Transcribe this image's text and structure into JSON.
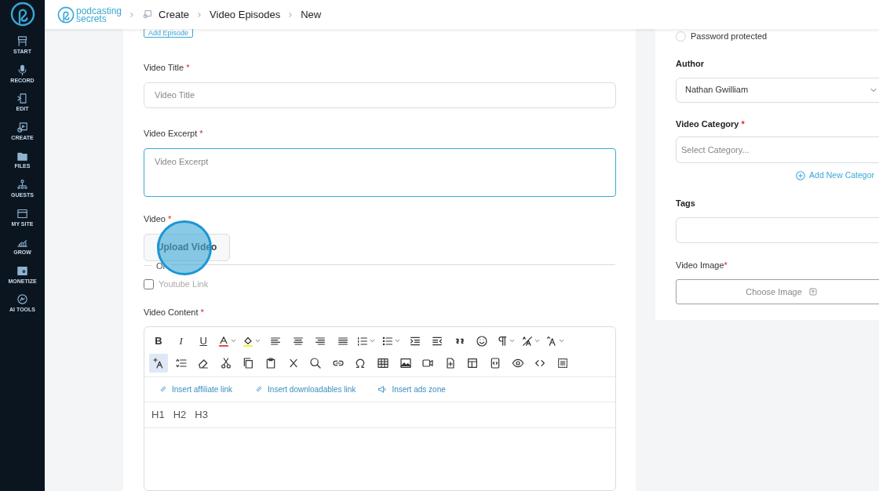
{
  "sidebar": {
    "items": [
      {
        "kind": "start",
        "label": "START"
      },
      {
        "kind": "record",
        "label": "RECORD"
      },
      {
        "kind": "edit",
        "label": "EDIT"
      },
      {
        "kind": "create",
        "label": "CREATE"
      },
      {
        "kind": "files",
        "label": "FILES"
      },
      {
        "kind": "guests",
        "label": "GUESTS"
      },
      {
        "kind": "site",
        "label": "MY SITE"
      },
      {
        "kind": "grow",
        "label": "GROW"
      },
      {
        "kind": "monetize",
        "label": "MONETIZE"
      },
      {
        "kind": "ai",
        "label": "AI TOOLS"
      }
    ]
  },
  "header": {
    "logo_top": "podcasting",
    "logo_bottom": "secrets",
    "breadcrumb": [
      "Create",
      "Video Episodes",
      "New"
    ]
  },
  "form": {
    "add_episode_button": "Add Episode",
    "title_label": "Video Title",
    "title_placeholder": "Video Title",
    "excerpt_label": "Video Excerpt",
    "excerpt_placeholder": "Video Excerpt",
    "video_label": "Video",
    "upload_button": "Upload Video",
    "or_text": "Or",
    "youtube": {
      "label": "Youtube Link",
      "checked": false
    },
    "content_label": "Video Content",
    "required_mark": "*",
    "toolbar_rows": [
      [
        {
          "kind": "bold",
          "label": "B",
          "selected": false
        },
        {
          "kind": "italic",
          "label": "I",
          "selected": false
        },
        {
          "kind": "underline",
          "label": "U",
          "selected": false
        },
        {
          "kind": "font-color",
          "selected": false
        },
        {
          "kind": "highlight",
          "selected": false
        },
        {
          "kind": "align-left",
          "selected": false
        },
        {
          "kind": "align-center",
          "selected": false
        },
        {
          "kind": "align-right",
          "selected": false
        },
        {
          "kind": "justify",
          "selected": false
        },
        {
          "kind": "ordered-list",
          "selected": false
        },
        {
          "kind": "bullet-list",
          "selected": false
        },
        {
          "kind": "indent",
          "selected": false
        },
        {
          "kind": "outdent",
          "selected": false
        },
        {
          "kind": "quote",
          "selected": false
        },
        {
          "kind": "emoji",
          "selected": false
        },
        {
          "kind": "paragraph",
          "selected": false
        },
        {
          "kind": "font-size",
          "selected": false
        },
        {
          "kind": "text-case",
          "selected": false
        }
      ],
      [
        {
          "kind": "add-format",
          "selected": true
        },
        {
          "kind": "line-height",
          "selected": false
        },
        {
          "kind": "eraser",
          "selected": false
        },
        {
          "kind": "cut",
          "selected": false
        },
        {
          "kind": "copy",
          "selected": false
        },
        {
          "kind": "paste",
          "selected": false
        },
        {
          "kind": "clear",
          "selected": false
        },
        {
          "kind": "search",
          "selected": false
        },
        {
          "kind": "link",
          "selected": false
        },
        {
          "kind": "omega",
          "selected": false
        },
        {
          "kind": "table",
          "selected": false
        },
        {
          "kind": "image",
          "selected": false
        },
        {
          "kind": "video",
          "selected": false
        },
        {
          "kind": "file-add",
          "selected": false
        },
        {
          "kind": "layout",
          "selected": false
        },
        {
          "kind": "embed",
          "selected": false
        },
        {
          "kind": "preview",
          "selected": false
        },
        {
          "kind": "code",
          "selected": false
        },
        {
          "kind": "select-all",
          "selected": false
        }
      ]
    ],
    "insert_links": [
      {
        "kind": "link",
        "label": "Insert affiliate link"
      },
      {
        "kind": "link",
        "label": "Insert downloadables link"
      },
      {
        "kind": "megaphone",
        "label": "Insert ads zone"
      }
    ],
    "headings": [
      "H1",
      "H2",
      "H3"
    ]
  },
  "side": {
    "password": {
      "label": "Password protected",
      "selected": false
    },
    "author_label": "Author",
    "author_value": "Nathan Gwilliam",
    "category_label": "Video Category",
    "category_placeholder": "Select Category...",
    "add_category": "Add New Categor",
    "tags_label": "Tags",
    "image_label": "Video Image",
    "choose_image": "Choose Image"
  },
  "click_marker": true
}
